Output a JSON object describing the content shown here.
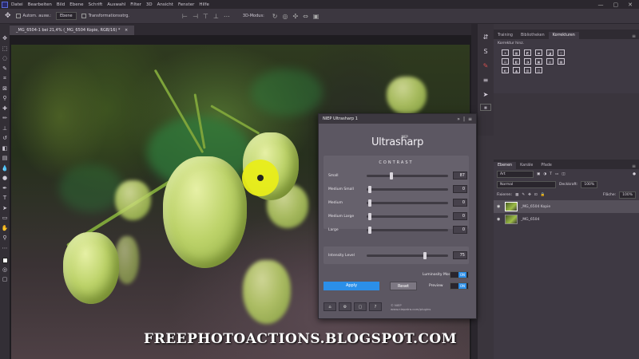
{
  "menubar": {
    "items": [
      "Datei",
      "Bearbeiten",
      "Bild",
      "Ebene",
      "Schrift",
      "Auswahl",
      "Filter",
      "3D",
      "Ansicht",
      "Fenster",
      "Hilfe"
    ],
    "win_min": "—",
    "win_max": "▢",
    "win_close": "✕"
  },
  "options": {
    "auto_select_label": "Autom. ausw.:",
    "auto_select_value": "Ebene",
    "transform_label": "Transformationsstrg.",
    "mode_3d": "3D-Modus:"
  },
  "document_tab": {
    "label": "_MG_6504-1 bei 21,4% (_MG_6504 Kopie, RGB/16) *",
    "close": "×"
  },
  "plugin": {
    "title": "NIEP Ultrasharp 1",
    "logo_small": "NIEP",
    "logo_text": "Ultrasharp",
    "contrast_heading": "CONTRAST",
    "sliders": [
      {
        "label": "Small",
        "value": "87",
        "position": 0.3
      },
      {
        "label": "Medium Small",
        "value": "0",
        "position": 0.02
      },
      {
        "label": "Medium",
        "value": "0",
        "position": 0.02
      },
      {
        "label": "Medium Large",
        "value": "0",
        "position": 0.02
      },
      {
        "label": "Large",
        "value": "0",
        "position": 0.02
      }
    ],
    "intensity": {
      "label": "Intensity Level",
      "value": "75",
      "position": 0.72
    },
    "luminosity_label": "Luminosity Mode",
    "luminosity_state": "ON",
    "preview_label": "Preview",
    "preview_state": "ON",
    "apply_label": "Apply",
    "reset_label": "Reset",
    "footer_line1": "© NIEP",
    "footer_line2": "www.niepatra.com/plugins"
  },
  "right_panel_top": {
    "tabs": [
      "Training",
      "Bibliotheken",
      "Korrekturen"
    ],
    "header": "Korrektur hinz.",
    "adjustments": [
      "☀",
      "▦",
      "◩",
      "▬",
      "◪",
      "▽",
      "⚖",
      "◧",
      "◑",
      "▣",
      "◎",
      "▦",
      "◐",
      "▲",
      "▥",
      "◫"
    ]
  },
  "layers_panel": {
    "tabs": [
      "Ebenen",
      "Kanäle",
      "Pfade"
    ],
    "filter_label": "Art",
    "blend_mode": "Normal",
    "opacity_label": "Deckkraft:",
    "opacity_value": "100%",
    "lock_label": "Fixieren:",
    "fill_label": "Fläche:",
    "fill_value": "100%",
    "layers": [
      {
        "name": "_MG_6504 Kopie",
        "selected": true
      },
      {
        "name": "_MG_6504",
        "selected": false
      }
    ]
  },
  "watermark": "FREEPHOTOACTIONS.BLOGSPOT.COM",
  "colors": {
    "apply": "#2b8fe8",
    "dialog_bg": "#5c5762",
    "cursor": "#e9ee1a"
  }
}
